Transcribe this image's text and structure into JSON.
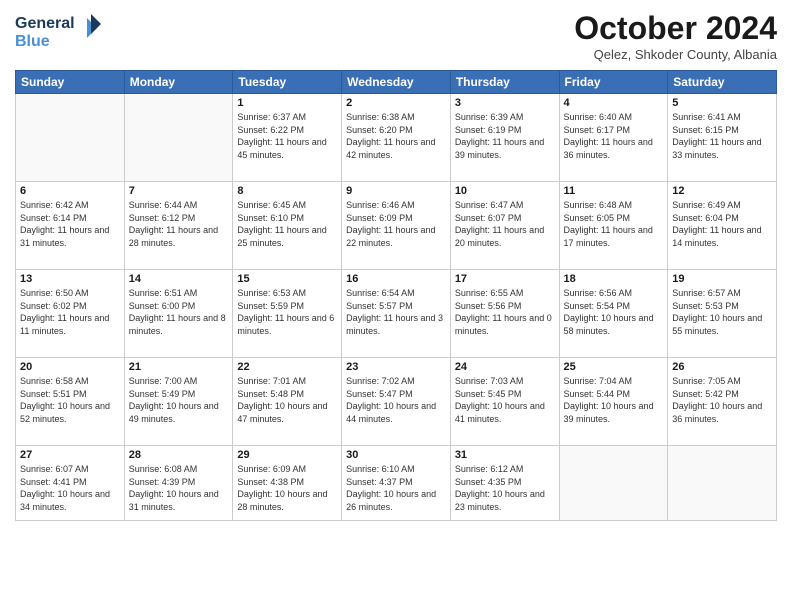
{
  "logo": {
    "line1": "General",
    "line2": "Blue"
  },
  "title": "October 2024",
  "subtitle": "Qelez, Shkoder County, Albania",
  "days_of_week": [
    "Sunday",
    "Monday",
    "Tuesday",
    "Wednesday",
    "Thursday",
    "Friday",
    "Saturday"
  ],
  "weeks": [
    [
      {
        "day": "",
        "content": ""
      },
      {
        "day": "",
        "content": ""
      },
      {
        "day": "1",
        "content": "Sunrise: 6:37 AM\nSunset: 6:22 PM\nDaylight: 11 hours and 45 minutes."
      },
      {
        "day": "2",
        "content": "Sunrise: 6:38 AM\nSunset: 6:20 PM\nDaylight: 11 hours and 42 minutes."
      },
      {
        "day": "3",
        "content": "Sunrise: 6:39 AM\nSunset: 6:19 PM\nDaylight: 11 hours and 39 minutes."
      },
      {
        "day": "4",
        "content": "Sunrise: 6:40 AM\nSunset: 6:17 PM\nDaylight: 11 hours and 36 minutes."
      },
      {
        "day": "5",
        "content": "Sunrise: 6:41 AM\nSunset: 6:15 PM\nDaylight: 11 hours and 33 minutes."
      }
    ],
    [
      {
        "day": "6",
        "content": "Sunrise: 6:42 AM\nSunset: 6:14 PM\nDaylight: 11 hours and 31 minutes."
      },
      {
        "day": "7",
        "content": "Sunrise: 6:44 AM\nSunset: 6:12 PM\nDaylight: 11 hours and 28 minutes."
      },
      {
        "day": "8",
        "content": "Sunrise: 6:45 AM\nSunset: 6:10 PM\nDaylight: 11 hours and 25 minutes."
      },
      {
        "day": "9",
        "content": "Sunrise: 6:46 AM\nSunset: 6:09 PM\nDaylight: 11 hours and 22 minutes."
      },
      {
        "day": "10",
        "content": "Sunrise: 6:47 AM\nSunset: 6:07 PM\nDaylight: 11 hours and 20 minutes."
      },
      {
        "day": "11",
        "content": "Sunrise: 6:48 AM\nSunset: 6:05 PM\nDaylight: 11 hours and 17 minutes."
      },
      {
        "day": "12",
        "content": "Sunrise: 6:49 AM\nSunset: 6:04 PM\nDaylight: 11 hours and 14 minutes."
      }
    ],
    [
      {
        "day": "13",
        "content": "Sunrise: 6:50 AM\nSunset: 6:02 PM\nDaylight: 11 hours and 11 minutes."
      },
      {
        "day": "14",
        "content": "Sunrise: 6:51 AM\nSunset: 6:00 PM\nDaylight: 11 hours and 8 minutes."
      },
      {
        "day": "15",
        "content": "Sunrise: 6:53 AM\nSunset: 5:59 PM\nDaylight: 11 hours and 6 minutes."
      },
      {
        "day": "16",
        "content": "Sunrise: 6:54 AM\nSunset: 5:57 PM\nDaylight: 11 hours and 3 minutes."
      },
      {
        "day": "17",
        "content": "Sunrise: 6:55 AM\nSunset: 5:56 PM\nDaylight: 11 hours and 0 minutes."
      },
      {
        "day": "18",
        "content": "Sunrise: 6:56 AM\nSunset: 5:54 PM\nDaylight: 10 hours and 58 minutes."
      },
      {
        "day": "19",
        "content": "Sunrise: 6:57 AM\nSunset: 5:53 PM\nDaylight: 10 hours and 55 minutes."
      }
    ],
    [
      {
        "day": "20",
        "content": "Sunrise: 6:58 AM\nSunset: 5:51 PM\nDaylight: 10 hours and 52 minutes."
      },
      {
        "day": "21",
        "content": "Sunrise: 7:00 AM\nSunset: 5:49 PM\nDaylight: 10 hours and 49 minutes."
      },
      {
        "day": "22",
        "content": "Sunrise: 7:01 AM\nSunset: 5:48 PM\nDaylight: 10 hours and 47 minutes."
      },
      {
        "day": "23",
        "content": "Sunrise: 7:02 AM\nSunset: 5:47 PM\nDaylight: 10 hours and 44 minutes."
      },
      {
        "day": "24",
        "content": "Sunrise: 7:03 AM\nSunset: 5:45 PM\nDaylight: 10 hours and 41 minutes."
      },
      {
        "day": "25",
        "content": "Sunrise: 7:04 AM\nSunset: 5:44 PM\nDaylight: 10 hours and 39 minutes."
      },
      {
        "day": "26",
        "content": "Sunrise: 7:05 AM\nSunset: 5:42 PM\nDaylight: 10 hours and 36 minutes."
      }
    ],
    [
      {
        "day": "27",
        "content": "Sunrise: 6:07 AM\nSunset: 4:41 PM\nDaylight: 10 hours and 34 minutes."
      },
      {
        "day": "28",
        "content": "Sunrise: 6:08 AM\nSunset: 4:39 PM\nDaylight: 10 hours and 31 minutes."
      },
      {
        "day": "29",
        "content": "Sunrise: 6:09 AM\nSunset: 4:38 PM\nDaylight: 10 hours and 28 minutes."
      },
      {
        "day": "30",
        "content": "Sunrise: 6:10 AM\nSunset: 4:37 PM\nDaylight: 10 hours and 26 minutes."
      },
      {
        "day": "31",
        "content": "Sunrise: 6:12 AM\nSunset: 4:35 PM\nDaylight: 10 hours and 23 minutes."
      },
      {
        "day": "",
        "content": ""
      },
      {
        "day": "",
        "content": ""
      }
    ]
  ]
}
